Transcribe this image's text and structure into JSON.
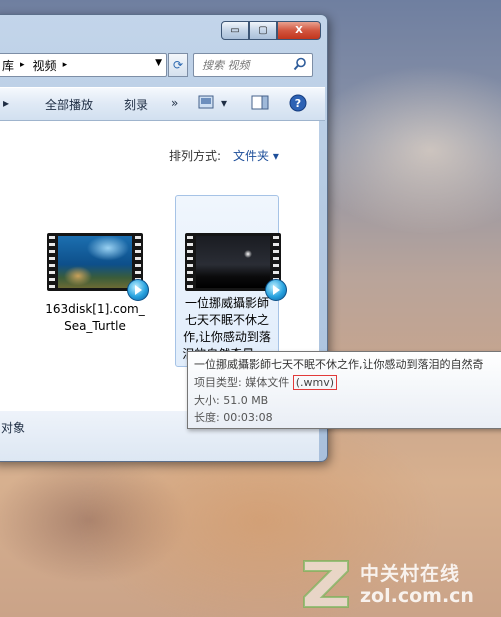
{
  "window": {
    "address": {
      "segments": [
        "库",
        "视频"
      ],
      "separator": "▸"
    },
    "search_placeholder": "搜索 视频",
    "caption": {
      "minimize": "▭",
      "maximize": "▢",
      "close": "X"
    }
  },
  "toolbar": {
    "more_left": "▸",
    "play_all": "全部播放",
    "burn": "刻录",
    "more": "»",
    "view_arrow": "▾"
  },
  "content": {
    "sort_label": "排列方式:",
    "sort_value": "文件夹 ▾",
    "files": [
      {
        "name": "163disk[1].com_Sea_Turtle",
        "name_lines": [
          "163disk[1].com_",
          "Sea_Turtle"
        ]
      },
      {
        "name": "一位挪威攝影師七天不眠不休之作,让你感动到落泪的自然奇景_...",
        "name_lines": [
          "一位挪威攝影師",
          "七天不眠不休之",
          "作,让你感动到落",
          "泪的自然奇景_..."
        ]
      }
    ]
  },
  "status": {
    "text": "对象"
  },
  "tooltip": {
    "title": "一位挪威攝影師七天不眠不休之作,让你感动到落泪的自然奇",
    "type_label": "项目类型: 媒体文件 ",
    "type_ext": "(.wmv)",
    "size": "大小: 51.0 MB",
    "length": "长度: 00:03:08"
  },
  "watermark": {
    "cn": "中关村在线",
    "url": "zol.com.cn"
  },
  "colors": {
    "accent": "#1e4f9a",
    "highlight_box": "#e23a3a"
  }
}
